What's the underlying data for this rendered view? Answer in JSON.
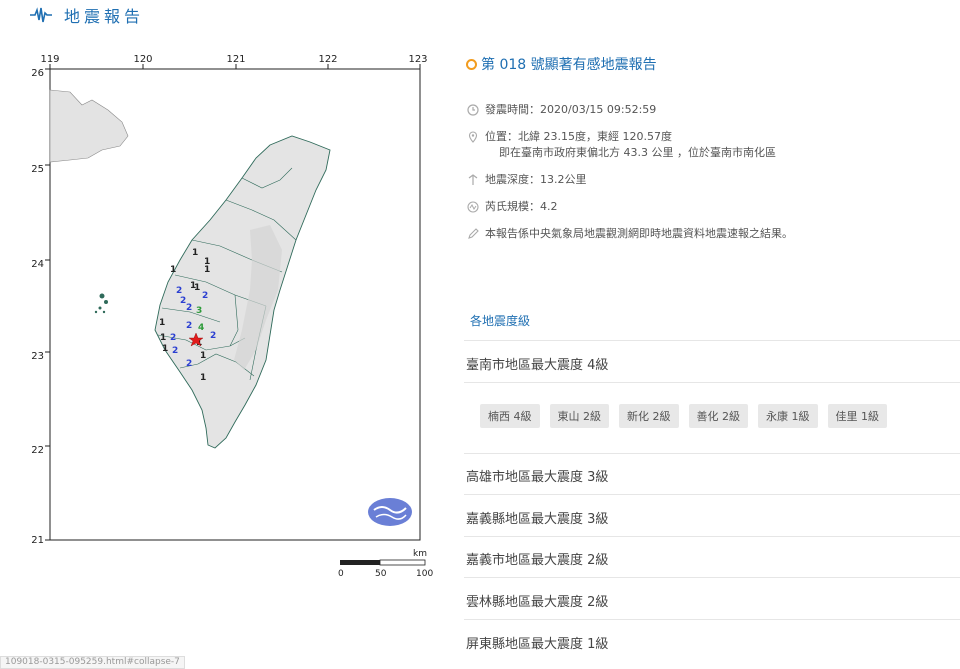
{
  "page": {
    "title": "地震報告"
  },
  "map": {
    "lon_ticks": [
      "119",
      "120",
      "121",
      "122",
      "123"
    ],
    "lat_ticks": [
      "26",
      "25",
      "24",
      "23",
      "22",
      "21"
    ],
    "scale_unit": "km",
    "scale_labels": [
      "0",
      "50",
      "100"
    ],
    "intensity_marks": [
      {
        "v": "1"
      },
      {
        "v": "1"
      },
      {
        "v": "1"
      },
      {
        "v": "1"
      },
      {
        "v": "1"
      },
      {
        "v": "1"
      },
      {
        "v": "2"
      },
      {
        "v": "2"
      },
      {
        "v": "2"
      },
      {
        "v": "2"
      },
      {
        "v": "3"
      },
      {
        "v": "2"
      },
      {
        "v": "2"
      },
      {
        "v": "4"
      },
      {
        "v": "2"
      },
      {
        "v": "1"
      },
      {
        "v": "1"
      },
      {
        "v": "2"
      },
      {
        "v": "2"
      },
      {
        "v": "1"
      },
      {
        "v": "1"
      },
      {
        "v": "1"
      },
      {
        "v": "1"
      }
    ],
    "colors": {
      "ocean": "#ffffff",
      "land": "#e6e6e6",
      "epicenter": "#e21b1b",
      "i1": "#222222",
      "i2": "#2b3fd1",
      "i3": "#2e9b3a",
      "i4": "#7a2fb3"
    }
  },
  "report": {
    "title": "第 018 號顯著有感地震報告",
    "time": "發震時間：2020/03/15 09:52:59",
    "location": "位置：北緯 23.15度，東經 120.57度",
    "location_sub": "即在臺南市政府東偏北方 43.3 公里 ，位於臺南市南化區",
    "depth": "地震深度：13.2公里",
    "magnitude": "芮氏規模：4.2",
    "note": "本報告係中央氣象局地震觀測網即時地震資料地震速報之結果。"
  },
  "intensity": {
    "link_label": "各地震度級",
    "regions": [
      {
        "label": "臺南市地區最大震度 4級"
      },
      {
        "label": "高雄市地區最大震度 3級"
      },
      {
        "label": "嘉義縣地區最大震度 3級"
      },
      {
        "label": "嘉義市地區最大震度 2級"
      },
      {
        "label": "雲林縣地區最大震度 2級"
      },
      {
        "label": "屏東縣地區最大震度 1級"
      }
    ],
    "tainan_stations": [
      "楠西 4級",
      "東山 2級",
      "新化 2級",
      "善化 2級",
      "永康 1級",
      "佳里 1級"
    ]
  },
  "status": {
    "url": "109018-0315-095259.html#collapse-7"
  }
}
